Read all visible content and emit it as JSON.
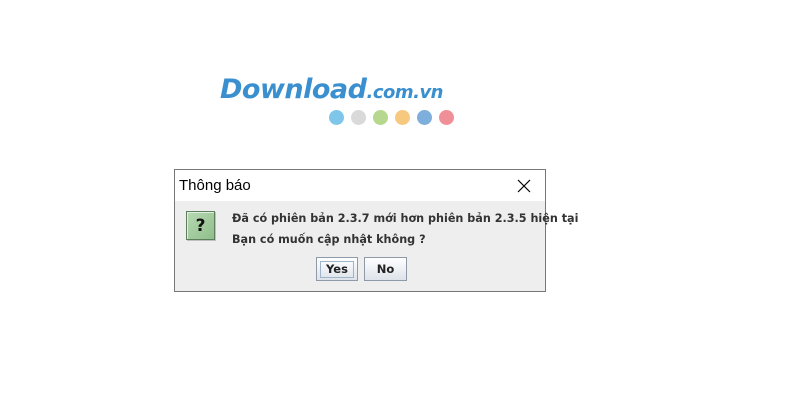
{
  "watermark": {
    "logo_main": "Download",
    "logo_tld": ".com.vn",
    "dot_colors": [
      "#7fc7ea",
      "#d9d9d9",
      "#b5d88e",
      "#f7c97e",
      "#7eaedb",
      "#f08f98"
    ]
  },
  "dialog": {
    "title": "Thông báo",
    "close_icon": "close-icon",
    "question_icon_glyph": "?",
    "message_line1": "Đã có phiên bản 2.3.7 mới hơn phiên bản 2.3.5 hiện tại",
    "message_line2": "Bạn có muốn cập nhật không ?",
    "yes_label": "Yes",
    "no_label": "No"
  }
}
